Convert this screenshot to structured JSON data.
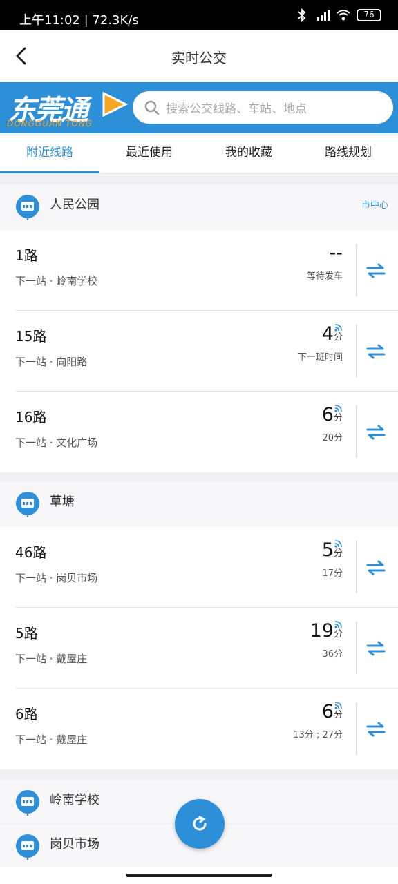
{
  "status_bar": {
    "time_speed": "上午11:02 | 72.3K/s",
    "battery": "76"
  },
  "header": {
    "title": "实时公交"
  },
  "banner": {
    "logo_cn": "东莞通",
    "logo_en": "DONGGUAN TONG",
    "search_placeholder": "搜索公交线路、车站、地点",
    "accent_color": "#2e8fd9",
    "logo_orange": "#f5a623"
  },
  "tabs": [
    {
      "label": "附近线路",
      "active": true
    },
    {
      "label": "最近使用",
      "active": false
    },
    {
      "label": "我的收藏",
      "active": false
    },
    {
      "label": "路线规划",
      "active": false
    }
  ],
  "stations": [
    {
      "name": "人民公园",
      "tag": "市中心",
      "routes": [
        {
          "name": "1路",
          "next_stop": "下一站 · 岭南学校",
          "time": "--",
          "unit": "",
          "sub": "等待发车",
          "realtime": false
        },
        {
          "name": "15路",
          "next_stop": "下一站 · 向阳路",
          "time": "4",
          "unit": "分",
          "sub": "下一班时间",
          "realtime": true
        },
        {
          "name": "16路",
          "next_stop": "下一站 · 文化广场",
          "time": "6",
          "unit": "分",
          "sub": "20分",
          "realtime": true
        }
      ]
    },
    {
      "name": "草塘",
      "tag": "",
      "routes": [
        {
          "name": "46路",
          "next_stop": "下一站 · 岗贝市场",
          "time": "5",
          "unit": "分",
          "sub": "17分",
          "realtime": true
        },
        {
          "name": "5路",
          "next_stop": "下一站 · 戴屋庄",
          "time": "19",
          "unit": "分",
          "sub": "36分",
          "realtime": true
        },
        {
          "name": "6路",
          "next_stop": "下一站 · 戴屋庄",
          "time": "6",
          "unit": "分",
          "sub": "13分 ; 27分",
          "realtime": true
        }
      ]
    },
    {
      "name": "岭南学校",
      "tag": "",
      "routes": []
    },
    {
      "name": "岗贝市场",
      "tag": "",
      "routes": []
    }
  ]
}
